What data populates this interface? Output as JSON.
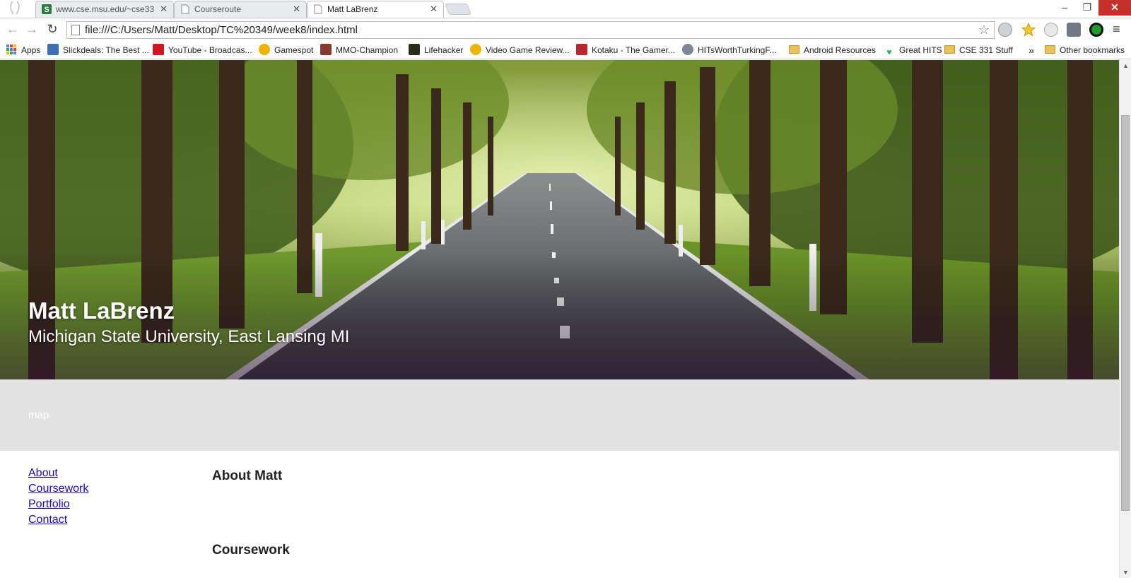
{
  "browser": {
    "tabs": [
      {
        "title": "www.cse.msu.edu/~cse33",
        "icon": "s-site-icon"
      },
      {
        "title": "Courseroute",
        "icon": "page-icon"
      },
      {
        "title": "Matt LaBrenz",
        "icon": "page-icon",
        "active": true
      }
    ],
    "url": "file:///C:/Users/Matt/Desktop/TC%20349/week8/index.html",
    "bookmarks": [
      {
        "label": "Apps",
        "icon": "apps-grid-icon"
      },
      {
        "label": "Slickdeals: The Best ...",
        "icon": "slickdeals-icon"
      },
      {
        "label": "YouTube - Broadcas...",
        "icon": "youtube-icon"
      },
      {
        "label": "Gamespot",
        "icon": "gamespot-icon"
      },
      {
        "label": "MMO-Champion",
        "icon": "mmo-champion-icon"
      },
      {
        "label": "Lifehacker",
        "icon": "lifehacker-icon"
      },
      {
        "label": "Video Game Review...",
        "icon": "gamespot-icon"
      },
      {
        "label": "Kotaku - The Gamer...",
        "icon": "kotaku-icon"
      },
      {
        "label": "HITsWorthTurkingF...",
        "icon": "hits-icon"
      },
      {
        "label": "Android Resources",
        "icon": "folder-icon"
      },
      {
        "label": "Great HITS",
        "icon": "heart-icon"
      },
      {
        "label": "CSE 331 Stuff",
        "icon": "folder-icon"
      }
    ],
    "overflow_label": "»",
    "other_bookmarks": "Other bookmarks"
  },
  "page": {
    "hero": {
      "name": "Matt LaBrenz",
      "subtitle": "Michigan State University, East Lansing MI"
    },
    "map_label": "map",
    "nav": [
      "About",
      "Coursework",
      "Portfolio",
      "Contact"
    ],
    "sections": [
      "About Matt",
      "Coursework"
    ]
  },
  "colors": {
    "link": "#1a0dab",
    "map_band": "#e2e2e2",
    "close_button": "#c7302a"
  }
}
